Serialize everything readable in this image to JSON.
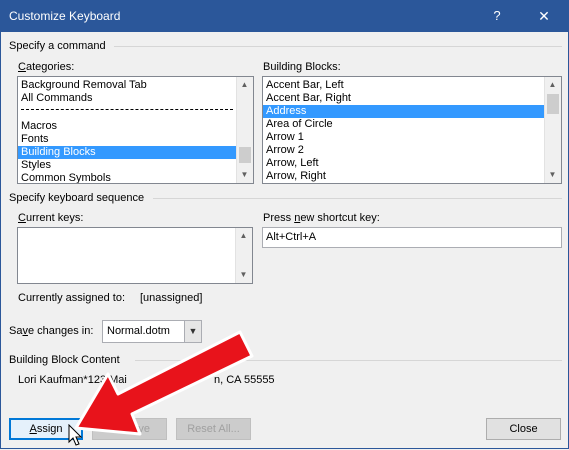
{
  "window": {
    "title": "Customize Keyboard",
    "help_glyph": "?",
    "close_glyph": "✕"
  },
  "specify_command": {
    "group_title": "Specify a command",
    "categories_label_ul": "C",
    "categories_label_rest": "ategories:",
    "categories": [
      "Background Removal Tab",
      "All Commands",
      "---",
      "Macros",
      "Fonts",
      "Building Blocks",
      "Styles",
      "Common Symbols"
    ],
    "categories_selected": "Building Blocks",
    "building_blocks_label": "Building Blocks:",
    "building_blocks": [
      "Accent Bar, Left",
      "Accent Bar, Right",
      "Address",
      "Area of Circle",
      "Arrow 1",
      "Arrow 2",
      "Arrow, Left",
      "Arrow, Right"
    ],
    "building_blocks_selected": "Address"
  },
  "keyboard_sequence": {
    "group_title": "Specify keyboard sequence",
    "current_keys_label_ul": "C",
    "current_keys_label_rest": "urrent keys:",
    "press_new_label_pre": "Press ",
    "press_new_label_ul": "n",
    "press_new_label_post": "ew shortcut key:",
    "new_shortcut_value": "Alt+Ctrl+A",
    "currently_assigned_label": "Currently assigned to:",
    "currently_assigned_value": "[unassigned]"
  },
  "save_changes": {
    "label_pre": "Sa",
    "label_ul": "v",
    "label_post": "e changes in:",
    "value": "Normal.dotm",
    "dropdown_glyph": "▼"
  },
  "content": {
    "group_title": "Building Block Content",
    "text_left": "Lori Kaufman*123 Mai",
    "text_right": "n, CA 55555"
  },
  "buttons": {
    "assign": "Assign",
    "assign_ul": "A",
    "assign_rest": "ssign",
    "remove": "Remove",
    "reset_all": "Reset All...",
    "close": "Close"
  },
  "scroll": {
    "up": "▲",
    "down": "▼"
  },
  "overlay": {
    "arrow_color": "#e8131b"
  }
}
